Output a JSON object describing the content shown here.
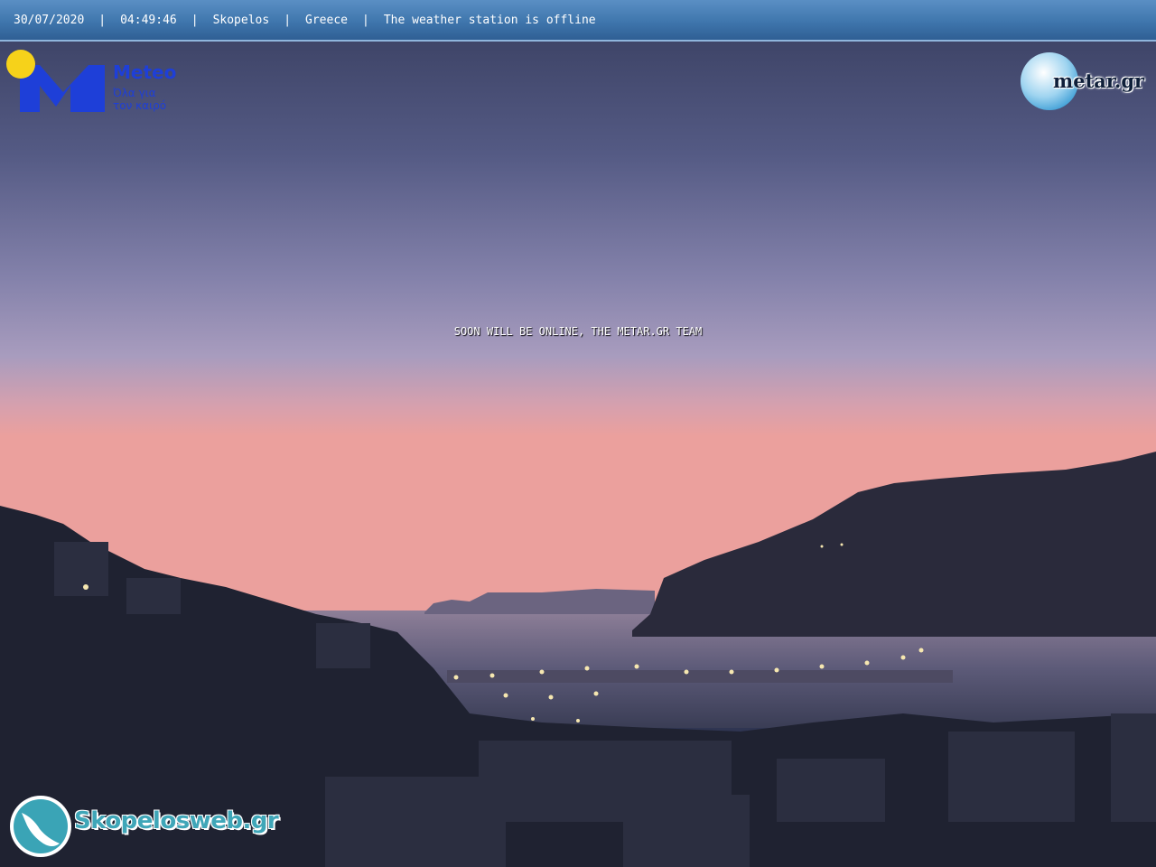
{
  "header": {
    "date": "30/07/2020",
    "time": "04:49:46",
    "location": "Skopelos",
    "country": "Greece",
    "status": "The weather station is offline",
    "separator": "|"
  },
  "message": "SOON WILL BE ONLINE, THE METAR.GR TEAM",
  "logos": {
    "meteo": {
      "name": "Meteo",
      "tagline_1": "Όλα για",
      "tagline_2": "τον καιρό"
    },
    "metar": {
      "name": "metar.gr"
    },
    "skopelosweb": {
      "name": "Skopelosweb.gr"
    }
  },
  "colors": {
    "sky_top": "#3d4466",
    "sky_mid": "#8a87b0",
    "sky_horizon": "#e8a3a6",
    "header_bar": "#3f76ad",
    "meteo_blue": "#1e3fd8",
    "meteo_sun": "#f6d21a"
  }
}
